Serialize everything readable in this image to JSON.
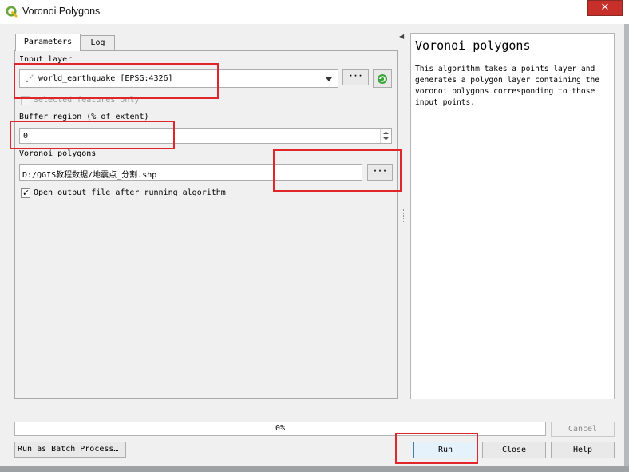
{
  "window": {
    "title": "Voronoi Polygons",
    "close_glyph": "✕",
    "logo_icon": "qgis-logo-icon"
  },
  "tabs": [
    {
      "label": "Parameters"
    },
    {
      "label": "Log"
    }
  ],
  "params": {
    "input_layer_label": "Input layer",
    "input_layer_value": "world_earthquake [EPSG:4326]",
    "input_layer_icon": "point-layer-icon",
    "browse_glyph": "···",
    "refresh_icon": "iterate-icon",
    "selected_only_label": "Selected features only",
    "buffer_label": "Buffer region (% of extent)",
    "buffer_value": "0",
    "output_label": "Voronoi polygons",
    "output_value": "D:/QGIS教程数据/地震点_分割.shp",
    "open_output_label": "Open output file after running algorithm",
    "open_output_checked": "✓"
  },
  "help": {
    "title": "Voronoi polygons",
    "text": "This algorithm takes a points layer and generates a polygon layer containing the voronoi polygons corresponding to those input points."
  },
  "collapse_glyph": "◀",
  "footer": {
    "progress_text": "0%",
    "progress_fraction": 0,
    "cancel_label": "Cancel",
    "batch_label": "Run as Batch Process…",
    "run_label": "Run",
    "close_label": "Close",
    "help_label": "Help"
  },
  "colors": {
    "highlight": "#e0262b",
    "close_button": "#c7302a"
  }
}
